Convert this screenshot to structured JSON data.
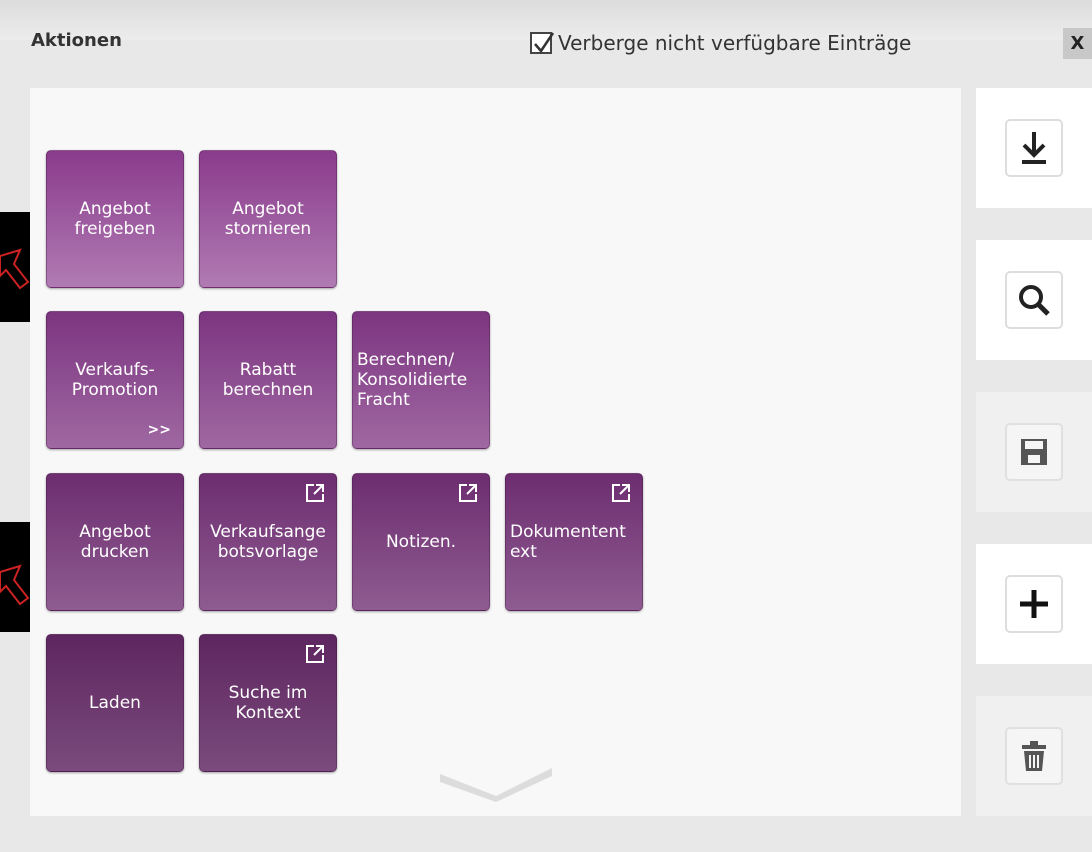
{
  "dialog": {
    "title": "Aktionen",
    "hide_unavailable_label": "Verberge nicht verfügbare Einträge",
    "hide_unavailable_checked": true,
    "close_label": "X"
  },
  "tiles": [
    {
      "id": "angebot-freigeben",
      "label": "Angebot\nfreigeben",
      "row": 1,
      "col": 1,
      "external": false,
      "more": false
    },
    {
      "id": "angebot-stornieren",
      "label": "Angebot\nstornieren",
      "row": 1,
      "col": 2,
      "external": false,
      "more": false
    },
    {
      "id": "verkaufs-promotion",
      "label": "Verkaufs-\nPromotion",
      "row": 2,
      "col": 1,
      "external": false,
      "more": true,
      "more_label": ">>"
    },
    {
      "id": "rabatt-berechnen",
      "label": "Rabatt\nberechnen",
      "row": 2,
      "col": 2,
      "external": false,
      "more": false
    },
    {
      "id": "berechnen-fracht",
      "label": "Berechnen/\nKonsolidierte\nFracht",
      "row": 2,
      "col": 3,
      "external": false,
      "more": false,
      "align": "left"
    },
    {
      "id": "angebot-drucken",
      "label": "Angebot\ndrucken",
      "row": 3,
      "col": 1,
      "external": false,
      "more": false
    },
    {
      "id": "verkaufsangebotsvorlage",
      "label": "Verkaufsange\nbotsvorlage",
      "row": 3,
      "col": 2,
      "external": true,
      "more": false
    },
    {
      "id": "notizen",
      "label": "Notizen.",
      "row": 3,
      "col": 3,
      "external": true,
      "more": false
    },
    {
      "id": "dokumententext",
      "label": "Dokumentent\next",
      "row": 3,
      "col": 4,
      "external": true,
      "more": false,
      "align": "left"
    },
    {
      "id": "laden",
      "label": "Laden",
      "row": 4,
      "col": 1,
      "external": false,
      "more": false
    },
    {
      "id": "suche-im-kontext",
      "label": "Suche im\nKontext",
      "row": 4,
      "col": 2,
      "external": true,
      "more": false
    }
  ],
  "sidebar": [
    {
      "id": "download",
      "icon": "download-icon",
      "enabled": true
    },
    {
      "id": "search",
      "icon": "search-icon",
      "enabled": true
    },
    {
      "id": "save",
      "icon": "save-icon",
      "enabled": false
    },
    {
      "id": "add",
      "icon": "plus-icon",
      "enabled": true
    },
    {
      "id": "delete",
      "icon": "trash-icon",
      "enabled": false
    }
  ]
}
